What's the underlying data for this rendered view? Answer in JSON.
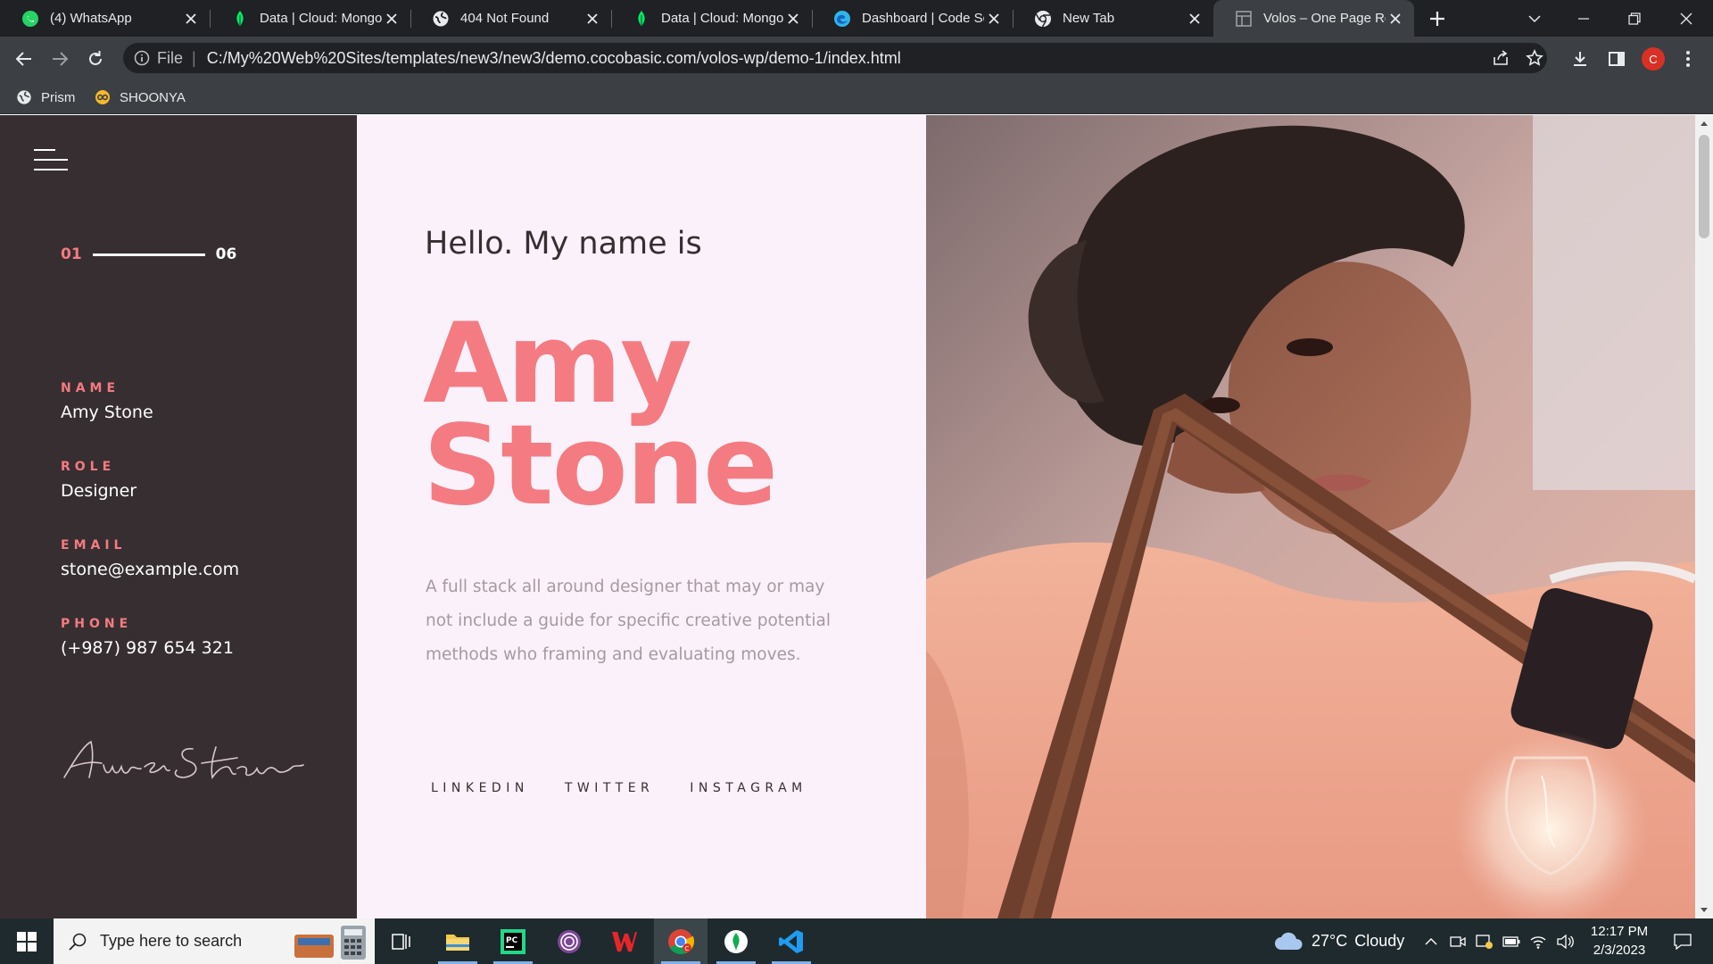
{
  "browser": {
    "tabs": [
      {
        "title": "(4) WhatsApp",
        "icon": "whatsapp-icon"
      },
      {
        "title": "Data | Cloud: MongoDB",
        "icon": "mongodb-leaf-icon"
      },
      {
        "title": "404 Not Found",
        "icon": "globe-icon"
      },
      {
        "title": "Data | Cloud: MongoDB",
        "icon": "mongodb-leaf-icon"
      },
      {
        "title": "Dashboard | Code Scan",
        "icon": "edge-icon"
      },
      {
        "title": "New Tab",
        "icon": "chrome-icon"
      },
      {
        "title": "Volos – One Page Resume",
        "icon": "page-icon",
        "active": true
      }
    ],
    "address": {
      "scheme_label": "File",
      "url": "C:/My%20Web%20Sites/templates/new3/new3/demo.cocobasic.com/volos-wp/demo-1/index.html"
    },
    "profile_initial": "C",
    "bookmarks": [
      {
        "label": "Prism",
        "icon": "globe-icon"
      },
      {
        "label": "SHOONYA",
        "icon": "shoonya-icon"
      }
    ]
  },
  "page": {
    "counter": {
      "current": "01",
      "total": "06"
    },
    "info": [
      {
        "label": "NAME",
        "value": "Amy Stone"
      },
      {
        "label": "ROLE",
        "value": "Designer"
      },
      {
        "label": "EMAIL",
        "value": "stone@example.com"
      },
      {
        "label": "PHONE",
        "value": "(+987) 987 654 321"
      }
    ],
    "greeting": "Hello. My name is",
    "first_name": "Amy",
    "last_name": "Stone",
    "bio": "A full stack all around designer that may or may not include a guide for specific creative potential methods who framing and evaluating moves.",
    "socials": [
      "LINKEDIN",
      "TWITTER",
      "INSTAGRAM"
    ]
  },
  "taskbar": {
    "search_placeholder": "Type here to search",
    "weather": {
      "temp": "27°C",
      "condition": "Cloudy"
    },
    "time": "12:17 PM",
    "date": "2/3/2023"
  },
  "colors": {
    "accent": "#f47b82",
    "sidebar": "#372e31",
    "content_bg": "#fbf1fb",
    "browser_dark": "#202124",
    "browser_toolbar": "#3c3f43",
    "taskbar": "#1f2a2e"
  }
}
